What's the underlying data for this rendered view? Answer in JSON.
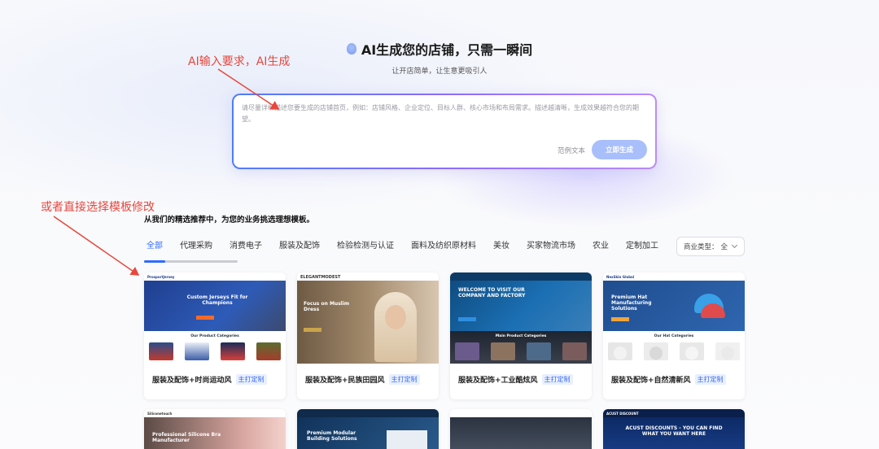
{
  "hero": {
    "title": "AI生成您的店铺，只需一瞬间",
    "subtitle": "让开店简单，让生意更吸引人"
  },
  "prompt": {
    "placeholder": "请尽量详细描述您要生成的店铺首页，例如：店铺风格、企业定位、目标人群、核心市场和布局需求。描述越清晰，生成效果越符合您的期望。",
    "example_link": "范例文本",
    "generate_button": "立即生成"
  },
  "annotations": {
    "ai_input": "AI输入要求，AI生成",
    "choose_template": "或者直接选择模板修改"
  },
  "section": {
    "heading": "从我们的精选推荐中，为您的业务挑选理想模板。",
    "tabs": [
      {
        "label": "全部",
        "active": true
      },
      {
        "label": "代理采购"
      },
      {
        "label": "消费电子"
      },
      {
        "label": "服装及配饰"
      },
      {
        "label": "检验检测与认证"
      },
      {
        "label": "面料及纺织原材料"
      },
      {
        "label": "美妆"
      },
      {
        "label": "买家物流市场"
      },
      {
        "label": "农业"
      },
      {
        "label": "定制加工"
      }
    ],
    "business_type_label": "商业类型：",
    "business_type_value": "全"
  },
  "cards": [
    {
      "title": "服装及配饰+时尚运动风",
      "badge": "主打定制",
      "hero_text": "Custom Jerseys Fit for Champions",
      "section_title": "Our Product Categories",
      "brand": "ProsportJersey"
    },
    {
      "title": "服装及配饰+民族田园风",
      "badge": "主打定制",
      "hero_text": "Focus on Muslim Dress",
      "brand": "ELEGANTMODEST"
    },
    {
      "title": "服装及配饰+工业酷炫风",
      "badge": "主打定制",
      "hero_text": "WELCOME TO VISIT OUR COMPANY AND FACTORY",
      "section_title": "Main Product Categories"
    },
    {
      "title": "服装及配饰+自然清新风",
      "badge": "主打定制",
      "hero_text": "Premium Hat Manufacturing Solutions",
      "section_title": "Our Hat Categories",
      "brand": "NexSkin Global"
    }
  ],
  "cards_row2": [
    {
      "hero_text": "Professional Silicone Bra Manufacturer",
      "brand": "Siliconetouch"
    },
    {
      "hero_text": "Premium Modular Building Solutions"
    },
    {
      "hero_text": ""
    },
    {
      "hero_text": "ACUST DISCOUNTS - YOU CAN FIND WHAT YOU WANT HERE",
      "brand": "ACUST DISCOUNT"
    }
  ],
  "colors": {
    "accent": "#2f6bff",
    "annotation": "#e8473c",
    "button": "#a9bffb"
  }
}
